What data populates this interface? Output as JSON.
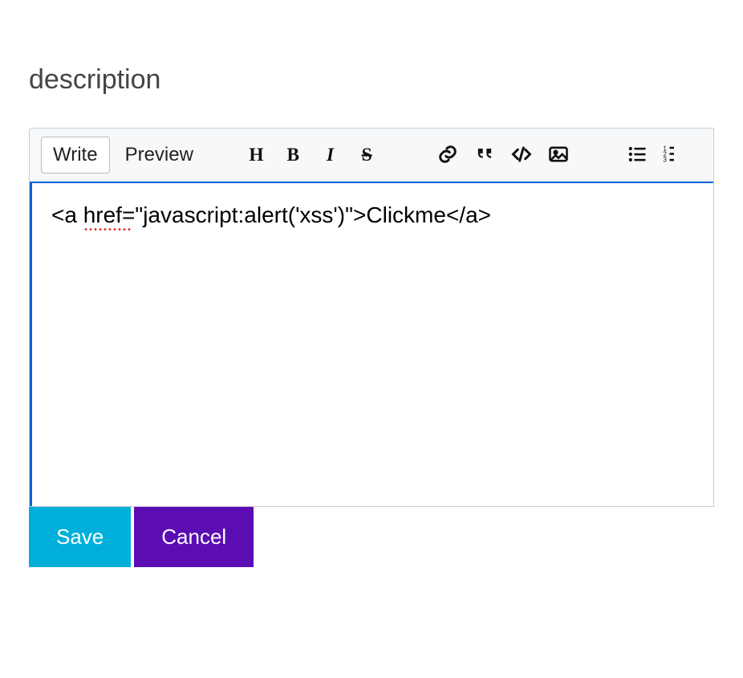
{
  "field": {
    "label": "description"
  },
  "tabs": {
    "write": "Write",
    "preview": "Preview"
  },
  "toolbar": {
    "heading": "heading-icon",
    "bold": "bold-icon",
    "italic": "italic-icon",
    "strike": "strikethrough-icon",
    "link": "link-icon",
    "quote": "quote-icon",
    "code": "code-icon",
    "image": "image-icon",
    "ul": "unordered-list-icon",
    "ol": "ordered-list-icon"
  },
  "editor": {
    "content": "<a href=\"javascript:alert('xss')\">Clickme</a>"
  },
  "buttons": {
    "save": "Save",
    "cancel": "Cancel"
  },
  "colors": {
    "focus": "#0b62d6",
    "save": "#00b0da",
    "cancel": "#5b0db3"
  }
}
